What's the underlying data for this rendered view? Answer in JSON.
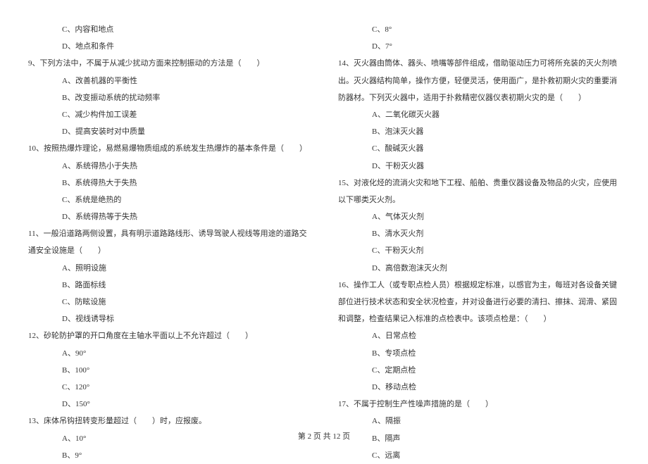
{
  "left": {
    "opt_c_8prev": "C、内容和地点",
    "opt_d_8prev": "D、地点和条件",
    "q9": "9、下列方法中，不属于从减少扰动方面来控制振动的方法是（　　）",
    "q9_a": "A、改善机器的平衡性",
    "q9_b": "B、改变振动系统的扰动频率",
    "q9_c": "C、减少构件加工误差",
    "q9_d": "D、提高安装时对中质量",
    "q10": "10、按照热爆炸理论，易燃易爆物质组成的系统发生热爆炸的基本条件是（　　）",
    "q10_a": "A、系统得热小于失热",
    "q10_b": "B、系统得热大于失热",
    "q10_c": "C、系统是绝热的",
    "q10_d": "D、系统得热等于失热",
    "q11": "11、一般沿道路两侧设置，具有明示道路路线形、诱导驾驶人视线等用途的道路交通安全设施是（　　）",
    "q11_a": "A、照明设施",
    "q11_b": "B、路面标线",
    "q11_c": "C、防眩设施",
    "q11_d": "D、视线诱导标",
    "q12": "12、砂轮防护罩的开口角度在主轴水平面以上不允许超过（　　）",
    "q12_a": "A、90°",
    "q12_b": "B、100°",
    "q12_c": "C、120°",
    "q12_d": "D、150°",
    "q13": "13、床体吊钩扭转变形量超过（　　）时，应报废。",
    "q13_a": "A、10°",
    "q13_b": "B、9°"
  },
  "right": {
    "q13_c": "C、8°",
    "q13_d": "D、7°",
    "q14": "14、灭火器由筒体、器头、喷嘴等部件组成，借助驱动压力可将所充装的灭火剂喷出。灭火器结构简单，操作方便，轻便灵活，使用面广，是扑救初期火灾的重要消防器材。下列灭火器中，适用于扑救精密仪器仪表初期火灾的是（　　）",
    "q14_a": "A、二氧化碳灭火器",
    "q14_b": "B、泡沫灭火器",
    "q14_c": "C、酸碱灭火器",
    "q14_d": "D、干粉灭火器",
    "q15": "15、对液化烃的流淌火灾和地下工程、船舶、贵重仪器设备及物品的火灾，应使用以下哪类灭火剂。",
    "q15_a": "A、气体灭火剂",
    "q15_b": "B、清水灭火剂",
    "q15_c": "C、干粉灭火剂",
    "q15_d": "D、高倍数泡沫灭火剂",
    "q16": "16、操作工人（或专职点检人员）根据规定标准，以感官为主，每班对各设备关键部位进行技术状态和安全状况检查，并对设备进行必要的清扫、擦抹、润滑、紧固和调整，检查结果记入标准的点检表中。该项点检是：（　　）",
    "q16_a": "A、日常点检",
    "q16_b": "B、专项点检",
    "q16_c": "C、定期点检",
    "q16_d": "D、移动点检",
    "q17": "17、不属于控制生产性噪声措施的是（　　）",
    "q17_a": "A、隔振",
    "q17_b": "B、隔声",
    "q17_c": "C、远离"
  },
  "footer": "第 2 页 共 12 页"
}
